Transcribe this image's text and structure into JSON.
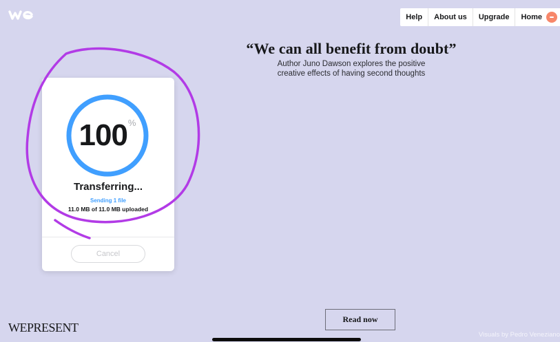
{
  "logo": {
    "icon": "we-logo-icon",
    "color": "#ffffff"
  },
  "nav": {
    "items": [
      {
        "label": "Help"
      },
      {
        "label": "About us"
      },
      {
        "label": "Upgrade"
      },
      {
        "label": "Home"
      }
    ],
    "avatar_color": "#f7876a"
  },
  "feature": {
    "quote": "“We can all benefit from doubt”",
    "sub_line1": "Author Juno Dawson explores the positive",
    "sub_line2": "creative effects of having second thoughts",
    "cta": "Read now",
    "brand": "WEPRESENT",
    "credit": "Visuals by Pedro Veneziano"
  },
  "transfer": {
    "percent": "100",
    "percent_sign": "%",
    "progress": 1.0,
    "title": "Transferring...",
    "status": "Sending 1 file",
    "uploaded": "11.0 MB of 11.0 MB uploaded",
    "cancel": "Cancel",
    "ring_color": "#409fff"
  },
  "annotation_color": "#b23be6",
  "background": "#d6d6ee"
}
